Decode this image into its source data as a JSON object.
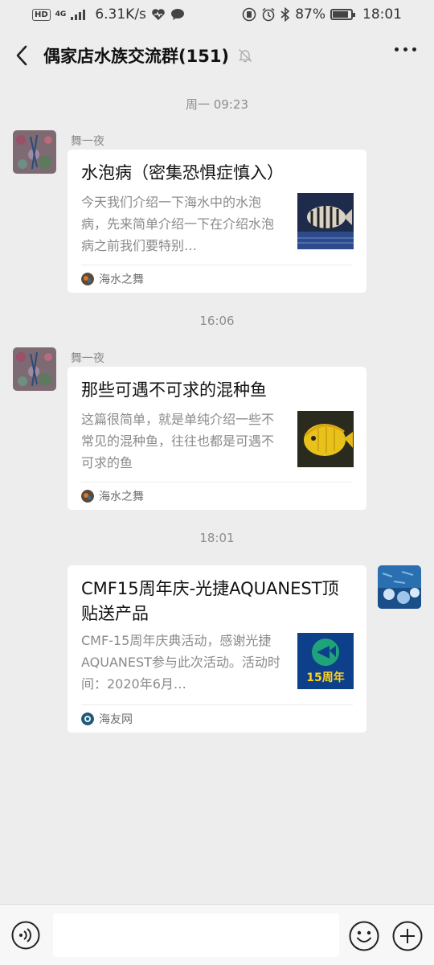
{
  "status_bar": {
    "network_badge": "HD",
    "network_type": "4G",
    "speed": "6.31K/s",
    "battery": "87%",
    "battery_level": 0.87,
    "time": "18:01"
  },
  "header": {
    "title": "偶家店水族交流群(151)"
  },
  "messages": [
    {
      "timestamp": "周一 09:23",
      "sender": "舞一夜",
      "title": "水泡病（密集恐惧症慎入）",
      "description": "今天我们介绍一下海水中的水泡病，先来简单介绍一下在介绍水泡病之前我们要特别…",
      "source": "海水之舞"
    },
    {
      "timestamp": "16:06",
      "sender": "舞一夜",
      "title": "那些可遇不可求的混种鱼",
      "description": "这篇很简单，就是单纯介绍一些不常见的混种鱼，往往也都是可遇不可求的鱼",
      "source": "海水之舞"
    },
    {
      "timestamp": "18:01",
      "title": "CMF15周年庆-光捷AQUANEST顶贴送产品",
      "description": "CMF-15周年庆典活动，感谢光捷AQUANEST参与此次活动。活动时间：2020年6月…",
      "source": "海友网",
      "thumb_text": "15周年"
    }
  ],
  "input_bar": {
    "placeholder": ""
  },
  "colors": {
    "background": "#ededed",
    "card": "#ffffff",
    "text_secondary": "#8a8a8a"
  }
}
